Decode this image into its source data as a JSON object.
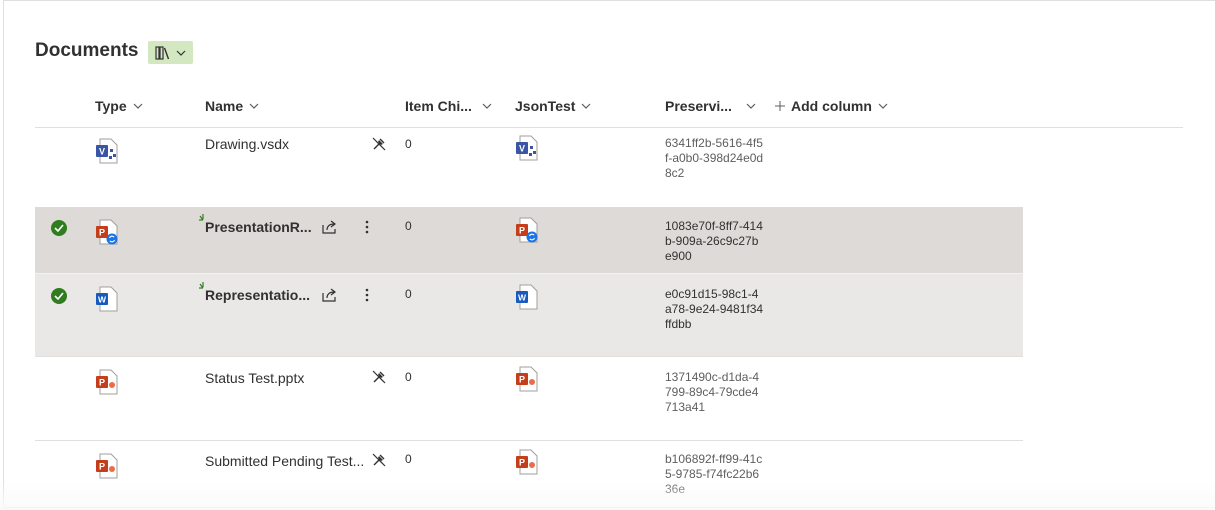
{
  "library": {
    "title": "Documents"
  },
  "columns": {
    "type": "Type",
    "name": "Name",
    "item_child": "Item Chi...",
    "json_test": "JsonTest",
    "preserving": "Preservi...",
    "add_column": "Add column"
  },
  "rows": [
    {
      "name": "Drawing.vsdx",
      "count": "0",
      "guid": "6341ff2b-5616-4f5f-a0b0-398d24e0d8c2",
      "file_type": "visio",
      "selected": false,
      "new": false
    },
    {
      "name": "PresentationR...",
      "count": "0",
      "guid": "1083e70f-8ff7-414b-909a-26c9c27be900",
      "file_type": "powerpoint-sync",
      "selected": true,
      "new": true
    },
    {
      "name": "Representatio...",
      "count": "0",
      "guid": "e0c91d15-98c1-4a78-9e24-9481f34ffdbb",
      "file_type": "word",
      "selected": true,
      "new": true
    },
    {
      "name": "Status Test.pptx",
      "count": "0",
      "guid": "1371490c-d1da-4799-89c4-79cde4713a41",
      "file_type": "powerpoint",
      "selected": false,
      "new": false
    },
    {
      "name": "Submitted Pending Test...",
      "count": "0",
      "guid": "b106892f-ff99-41c5-9785-f74fc22b636e",
      "file_type": "powerpoint",
      "selected": false,
      "new": false
    }
  ],
  "colors": {
    "selected_row": "#dddad7",
    "selected_row_light": "#e9e8e6",
    "check": "#2f7d1f",
    "view_button": "#d3e7c1",
    "powerpoint": "#c43e1c",
    "word": "#185abd",
    "visio": "#3955a3"
  }
}
